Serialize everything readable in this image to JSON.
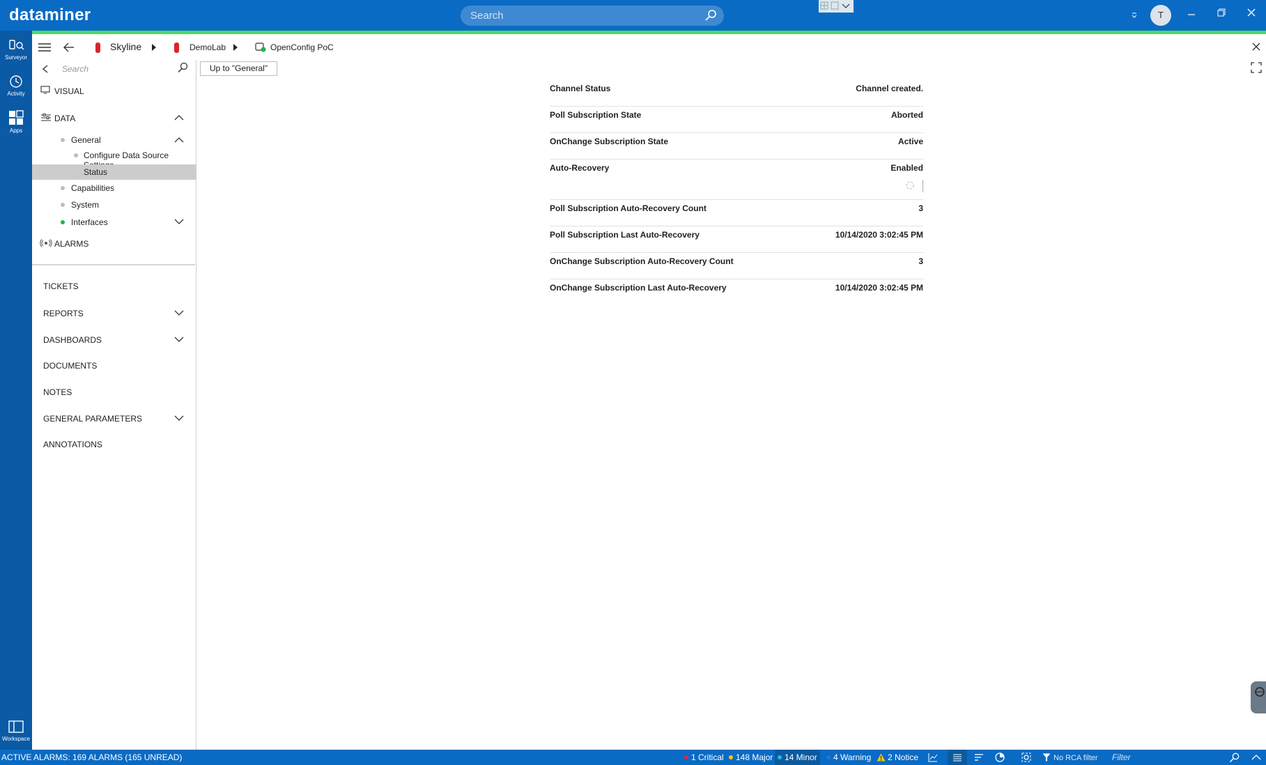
{
  "app": {
    "name": "dataminer"
  },
  "topbar": {
    "search_placeholder": "Search",
    "avatar_initial": "T"
  },
  "rail": [
    {
      "label": "Surveyor",
      "icon": "surveyor-icon"
    },
    {
      "label": "Activity",
      "icon": "activity-icon"
    },
    {
      "label": "Apps",
      "icon": "apps-icon"
    },
    {
      "label": "Workspace",
      "icon": "workspace-icon"
    }
  ],
  "breadcrumb": {
    "items": [
      "Skyline",
      "DemoLab",
      "OpenConfig PoC"
    ]
  },
  "sidebar": {
    "search_placeholder": "Search",
    "visual": "VISUAL",
    "data": "DATA",
    "general": "General",
    "configure": "Configure Data Source Settings",
    "status": "Status",
    "capabilities": "Capabilities",
    "system": "System",
    "interfaces": "Interfaces",
    "alarms": "ALARMS",
    "sections": [
      "TICKETS",
      "REPORTS",
      "DASHBOARDS",
      "DOCUMENTS",
      "NOTES",
      "GENERAL PARAMETERS",
      "ANNOTATIONS"
    ]
  },
  "main": {
    "up_button": "Up to \"General\"",
    "rows": [
      {
        "label": "Channel Status",
        "value": "Channel created."
      },
      {
        "label": "Poll Subscription State",
        "value": "Aborted"
      },
      {
        "label": "OnChange Subscription State",
        "value": "Active"
      },
      {
        "label": "Auto-Recovery",
        "value": "Enabled"
      },
      {
        "label": "Poll Subscription Auto-Recovery Count",
        "value": "3"
      },
      {
        "label": "Poll Subscription Last Auto-Recovery",
        "value": "10/14/2020 3:02:45 PM"
      },
      {
        "label": "OnChange Subscription Auto-Recovery Count",
        "value": "3"
      },
      {
        "label": "OnChange Subscription Last Auto-Recovery",
        "value": "10/14/2020 3:02:45 PM"
      }
    ]
  },
  "statusbar": {
    "active_alarms": "ACTIVE ALARMS: 169 ALARMS (165 UNREAD)",
    "critical": "1 Critical",
    "major": "148 Major",
    "minor": "14 Minor",
    "warning": "4 Warning",
    "notice": "2 Notice",
    "rca": "No RCA filter",
    "filter_placeholder": "Filter"
  },
  "colors": {
    "brand": "#0a6bc4",
    "rail": "#0a5aa6",
    "critical": "#e0273b",
    "major": "#f0c419",
    "minor": "#23b7e5",
    "warning": "#2f6fd6",
    "status_ok": "#22b24c"
  }
}
